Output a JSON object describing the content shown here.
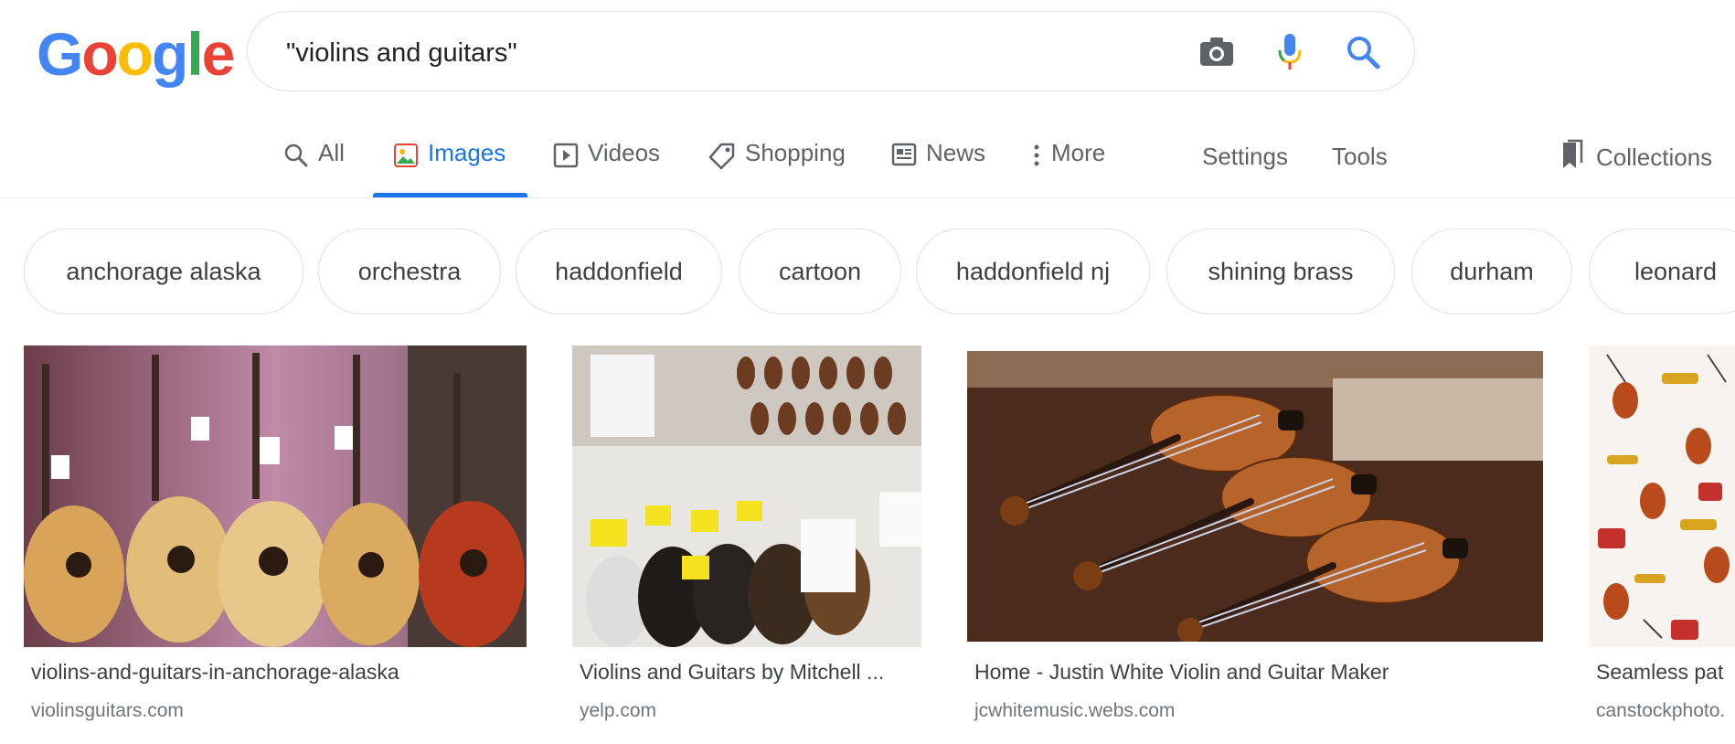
{
  "logo": {
    "letters": [
      "G",
      "o",
      "o",
      "g",
      "l",
      "e"
    ],
    "colors": [
      "#4285F4",
      "#EA4335",
      "#FBBC05",
      "#4285F4",
      "#34A853",
      "#EA4335"
    ]
  },
  "search": {
    "query": "\"violins and guitars\""
  },
  "icons": {
    "camera": "camera-icon",
    "mic": "microphone-icon",
    "search": "search-icon"
  },
  "tabs": [
    {
      "label": "All",
      "icon": "search-icon"
    },
    {
      "label": "Images",
      "icon": "image-icon",
      "active": true
    },
    {
      "label": "Videos",
      "icon": "play-icon"
    },
    {
      "label": "Shopping",
      "icon": "tag-icon"
    },
    {
      "label": "News",
      "icon": "newspaper-icon"
    },
    {
      "label": "More",
      "icon": "more-vert-icon"
    }
  ],
  "tools": {
    "settings": "Settings",
    "tools": "Tools",
    "collections": "Collections"
  },
  "chips": [
    "anchorage alaska",
    "orchestra",
    "haddonfield",
    "cartoon",
    "haddonfield nj",
    "shining brass",
    "durham",
    "leonard"
  ],
  "results": [
    {
      "caption": "violins-and-guitars-in-anchorage-alaska",
      "source": "violinsguitars.com"
    },
    {
      "caption": "Violins and Guitars by Mitchell ...",
      "source": "yelp.com"
    },
    {
      "caption": "Home - Justin White Violin and Guitar Maker",
      "source": "jcwhitemusic.webs.com"
    },
    {
      "caption": "Seamless pat",
      "source": "canstockphoto."
    }
  ],
  "colors": {
    "accent": "#1a73e8",
    "text_muted": "#5f6368"
  }
}
